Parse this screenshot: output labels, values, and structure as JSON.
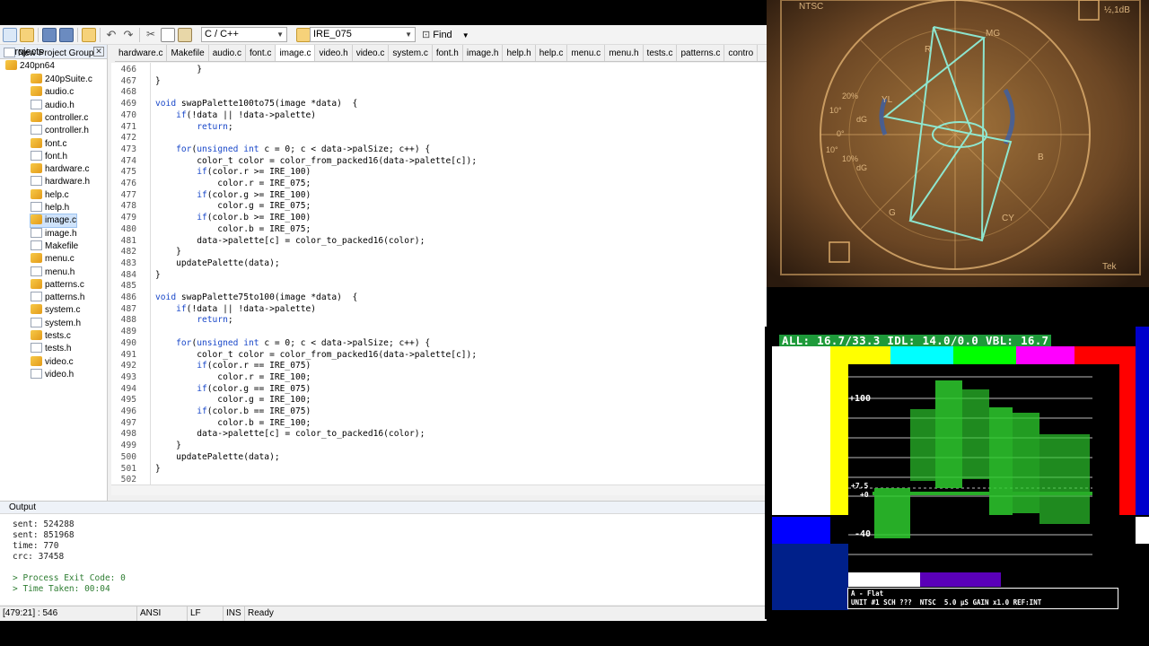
{
  "toolbar": {
    "language_value": "C / C++",
    "search_value": "IRE_075",
    "find_label": "Find"
  },
  "projects": {
    "title": "Projects",
    "root": "New Project Group",
    "project": "240pn64",
    "files": [
      "240pSuite.c",
      "audio.c",
      "audio.h",
      "controller.c",
      "controller.h",
      "font.c",
      "font.h",
      "hardware.c",
      "hardware.h",
      "help.c",
      "help.h",
      "image.c",
      "image.h",
      "Makefile",
      "menu.c",
      "menu.h",
      "patterns.c",
      "patterns.h",
      "system.c",
      "system.h",
      "tests.c",
      "tests.h",
      "video.c",
      "video.h"
    ],
    "selected": "image.c"
  },
  "tabs": [
    "hardware.c",
    "Makefile",
    "audio.c",
    "font.c",
    "image.c",
    "video.h",
    "video.c",
    "system.c",
    "font.h",
    "image.h",
    "help.h",
    "help.c",
    "menu.c",
    "menu.h",
    "tests.c",
    "patterns.c",
    "contro"
  ],
  "active_tab": "image.c",
  "editor": {
    "lines": [
      {
        "n": "466",
        "t": "        }"
      },
      {
        "n": "467",
        "t": "}"
      },
      {
        "n": "468",
        "t": ""
      },
      {
        "n": "469",
        "t": "void swapPalette100to75(image *data)  {"
      },
      {
        "n": "470",
        "t": "    if(!data || !data->palette)"
      },
      {
        "n": "471",
        "t": "        return;"
      },
      {
        "n": "472",
        "t": ""
      },
      {
        "n": "473",
        "t": "    for(unsigned int c = 0; c < data->palSize; c++) {"
      },
      {
        "n": "474",
        "t": "        color_t color = color_from_packed16(data->palette[c]);"
      },
      {
        "n": "475",
        "t": "        if(color.r >= IRE_100)"
      },
      {
        "n": "476",
        "t": "            color.r = IRE_075;"
      },
      {
        "n": "477",
        "t": "        if(color.g >= IRE_100)"
      },
      {
        "n": "478",
        "t": "            color.g = IRE_075;"
      },
      {
        "n": "479",
        "t": "        if(color.b >= IRE_100)"
      },
      {
        "n": "480",
        "t": "            color.b = IRE_075;"
      },
      {
        "n": "481",
        "t": "        data->palette[c] = color_to_packed16(color);"
      },
      {
        "n": "482",
        "t": "    }"
      },
      {
        "n": "483",
        "t": "    updatePalette(data);"
      },
      {
        "n": "484",
        "t": "}"
      },
      {
        "n": "485",
        "t": ""
      },
      {
        "n": "486",
        "t": "void swapPalette75to100(image *data)  {"
      },
      {
        "n": "487",
        "t": "    if(!data || !data->palette)"
      },
      {
        "n": "488",
        "t": "        return;"
      },
      {
        "n": "489",
        "t": ""
      },
      {
        "n": "490",
        "t": "    for(unsigned int c = 0; c < data->palSize; c++) {"
      },
      {
        "n": "491",
        "t": "        color_t color = color_from_packed16(data->palette[c]);"
      },
      {
        "n": "492",
        "t": "        if(color.r == IRE_075)"
      },
      {
        "n": "493",
        "t": "            color.r = IRE_100;"
      },
      {
        "n": "494",
        "t": "        if(color.g == IRE_075)"
      },
      {
        "n": "495",
        "t": "            color.g = IRE_100;"
      },
      {
        "n": "496",
        "t": "        if(color.b == IRE_075)"
      },
      {
        "n": "497",
        "t": "            color.b = IRE_100;"
      },
      {
        "n": "498",
        "t": "        data->palette[c] = color_to_packed16(color);"
      },
      {
        "n": "499",
        "t": "    }"
      },
      {
        "n": "500",
        "t": "    updatePalette(data);"
      },
      {
        "n": "501",
        "t": "}"
      },
      {
        "n": "502",
        "t": ""
      }
    ]
  },
  "output": {
    "title": "Output",
    "lines": [
      "sent: 524288",
      "sent: 851968",
      "time: 770",
      "crc: 37458",
      "",
      "> Process Exit Code: 0",
      "> Time Taken: 00:04"
    ]
  },
  "status": {
    "position": "[479:21] : 546",
    "encoding": "ANSI",
    "eol": "LF",
    "mode": "INS",
    "state": "Ready"
  },
  "vectorscope": {
    "top_label": "NTSC",
    "gain_label": "½,1dB",
    "brand": "Tek",
    "targets": [
      "R",
      "MG",
      "YL",
      "B",
      "G",
      "CY"
    ],
    "scale": [
      "20%",
      "10°",
      "0°",
      "10°",
      "10%",
      "dG",
      "dG"
    ]
  },
  "waveform": {
    "header": "ALL: 16.7/33.3  IDL: 14.0/0.0  VBL: 16.7",
    "scale": [
      "+100",
      "+7.5",
      "+0",
      "-40"
    ],
    "info_line1": "A - Flat",
    "info_line2": "UNIT #1 SCH ???  NTSC  5.0 µS GAIN x1.0 REF:INT"
  }
}
